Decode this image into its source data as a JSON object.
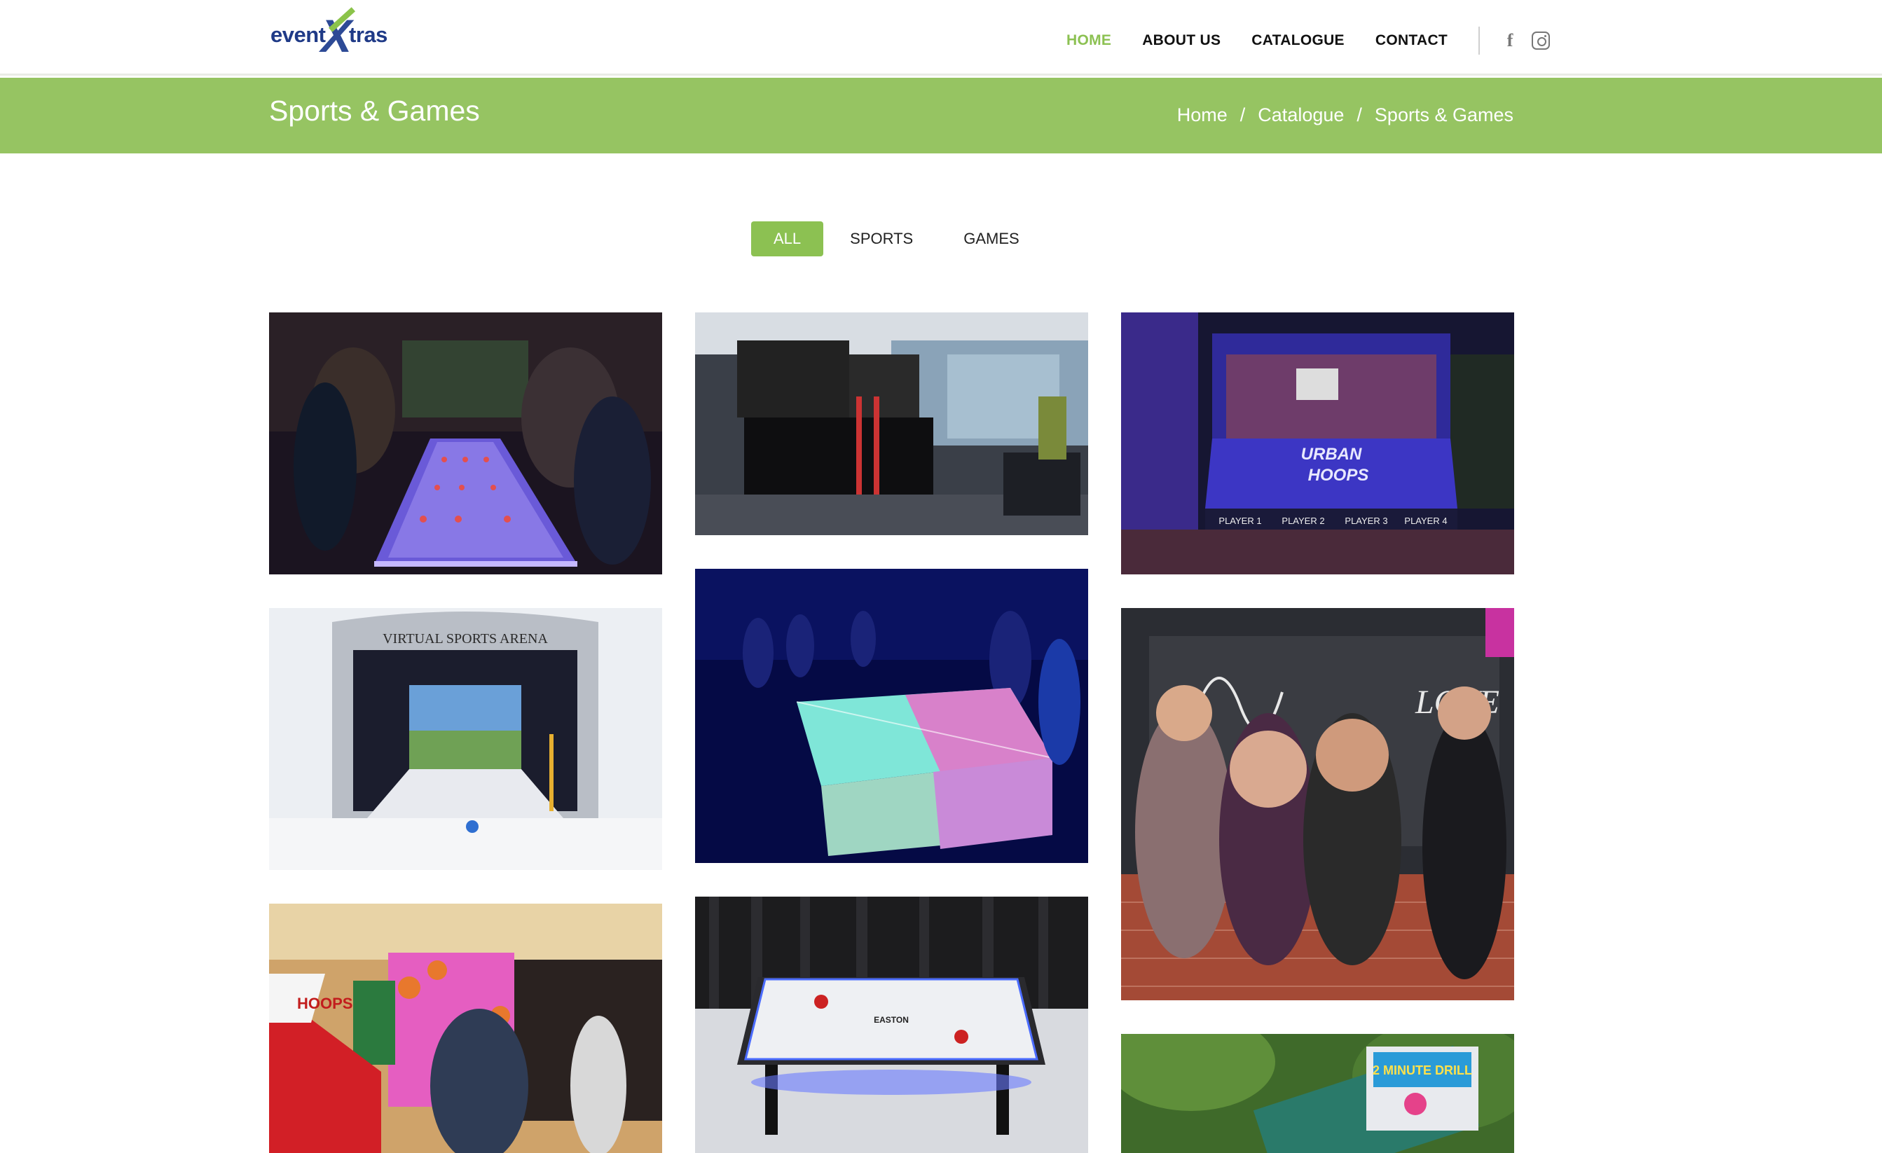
{
  "header": {
    "logo": {
      "part1": "event",
      "part2": "X",
      "part3": "tras"
    },
    "nav": [
      {
        "label": "HOME",
        "active": true
      },
      {
        "label": "ABOUT US",
        "active": false
      },
      {
        "label": "CATALOGUE",
        "active": false
      },
      {
        "label": "CONTACT",
        "active": false
      }
    ],
    "social": [
      "facebook-icon",
      "instagram-icon"
    ]
  },
  "title_bar": {
    "title": "Sports & Games",
    "breadcrumb": [
      "Home",
      "Catalogue",
      "Sports & Games"
    ]
  },
  "filters": [
    {
      "label": "ALL",
      "active": true
    },
    {
      "label": "SPORTS",
      "active": false
    },
    {
      "label": "GAMES",
      "active": false
    }
  ],
  "gallery": [
    {
      "name": "giant-foosball-photo"
    },
    {
      "name": "play-now-station-photo"
    },
    {
      "name": "urban-hoops-photo",
      "text": [
        "URBAN",
        "HOOPS",
        "PLAYER 1",
        "PLAYER 2",
        "PLAYER 3",
        "PLAYER 4"
      ]
    },
    {
      "name": "virtual-sports-arena-photo",
      "text": [
        "VIRTUAL SPORTS ARENA"
      ]
    },
    {
      "name": "led-ping-pong-photo"
    },
    {
      "name": "photo-booth-friends-photo",
      "text": [
        "LOVE"
      ]
    },
    {
      "name": "hoops-basketball-photo",
      "text": [
        "HOOPS"
      ]
    },
    {
      "name": "air-hockey-photo",
      "text": [
        "EASTON"
      ]
    },
    {
      "name": "two-minute-drill-photo",
      "text": [
        "2 MINUTE DRILL"
      ]
    }
  ],
  "colors": {
    "brand_green": "#8cc152",
    "titlebar_green": "#96c462",
    "logo_blue": "#1f3a87"
  }
}
